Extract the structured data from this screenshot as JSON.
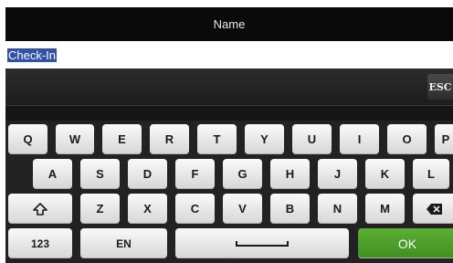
{
  "header": {
    "title": "Name"
  },
  "input": {
    "value": "Check-In"
  },
  "toolbar": {
    "esc_label": "ESC"
  },
  "keyboard": {
    "row1": [
      "Q",
      "W",
      "E",
      "R",
      "T",
      "Y",
      "U",
      "I",
      "O",
      "P"
    ],
    "row2": [
      "A",
      "S",
      "D",
      "F",
      "G",
      "H",
      "J",
      "K",
      "L"
    ],
    "row3": [
      "Z",
      "X",
      "C",
      "V",
      "B",
      "N",
      "M"
    ],
    "numbers_label": "123",
    "language_label": "EN",
    "ok_label": "OK"
  },
  "colors": {
    "selection": "#2f52a8",
    "ok_key": "#4c9f2a"
  },
  "icons": {
    "shift": "shift-icon",
    "backspace": "backspace-icon",
    "space": "space-icon"
  }
}
